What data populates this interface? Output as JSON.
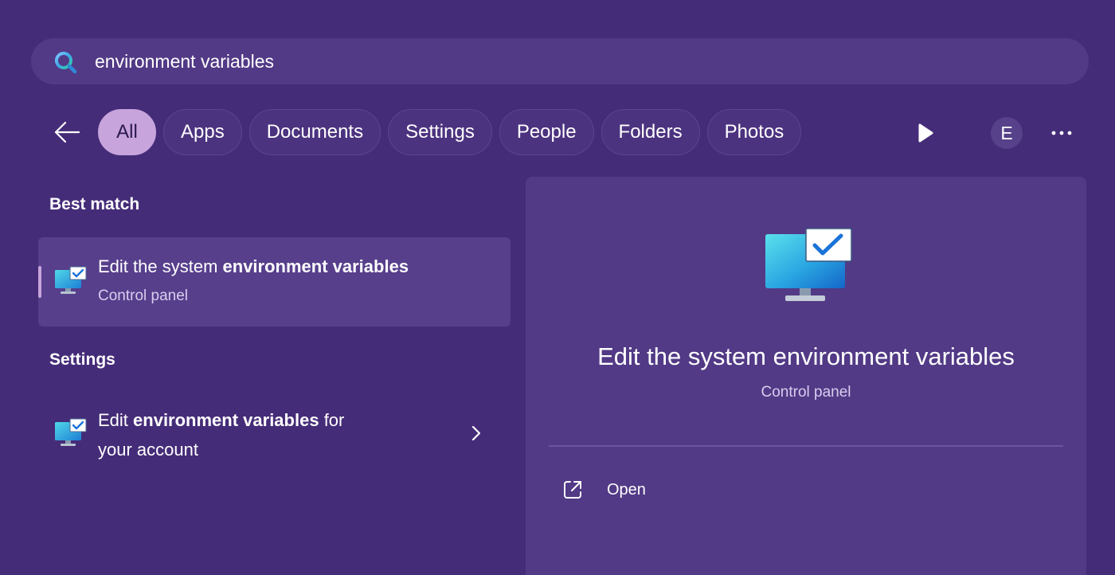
{
  "search": {
    "query": "environment variables"
  },
  "filters": [
    {
      "label": "All",
      "active": true
    },
    {
      "label": "Apps"
    },
    {
      "label": "Documents"
    },
    {
      "label": "Settings"
    },
    {
      "label": "People"
    },
    {
      "label": "Folders"
    },
    {
      "label": "Photos"
    }
  ],
  "header": {
    "avatar_initial": "E"
  },
  "best_match": {
    "heading": "Best match",
    "title_prefix": "Edit the system ",
    "title_bold": "environment variables",
    "subtitle": "Control panel"
  },
  "settings_section": {
    "heading": "Settings",
    "title_prefix": "Edit ",
    "title_bold": "environment variables",
    "title_suffix": " for",
    "title_line2": "your account"
  },
  "detail": {
    "title": "Edit the system environment variables",
    "subtitle": "Control panel",
    "open_label": "Open"
  },
  "icons": {
    "search": "search-icon",
    "back": "arrow-left-icon",
    "play": "play-icon",
    "more": "more-horizontal-icon",
    "control_panel": "monitor-check-icon",
    "chevron": "chevron-right-icon",
    "open": "external-link-icon"
  },
  "colors": {
    "background": "#452c78",
    "surface": "#523a86",
    "selected_item": "#573f8c",
    "accent": "#c7a4dc"
  }
}
